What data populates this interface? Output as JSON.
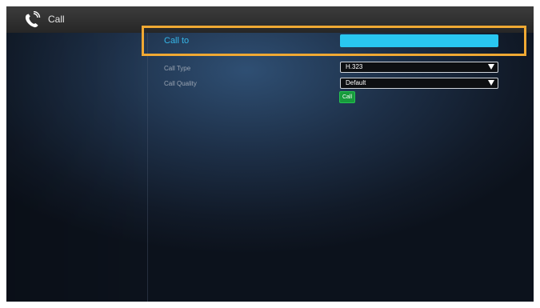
{
  "window": {
    "title": "Call",
    "icon": "phone-ringing-icon"
  },
  "form": {
    "call_to_label": "Call to",
    "call_to_value": "",
    "call_type_label": "Call Type",
    "call_type_value": "H.323",
    "call_quality_label": "Call Quality",
    "call_quality_value": "Default",
    "call_button": "Call"
  },
  "colors": {
    "highlight": "#f0a933",
    "accent": "#29c6f0",
    "call_button": "#179a3c",
    "active_label": "#36b7e8"
  }
}
